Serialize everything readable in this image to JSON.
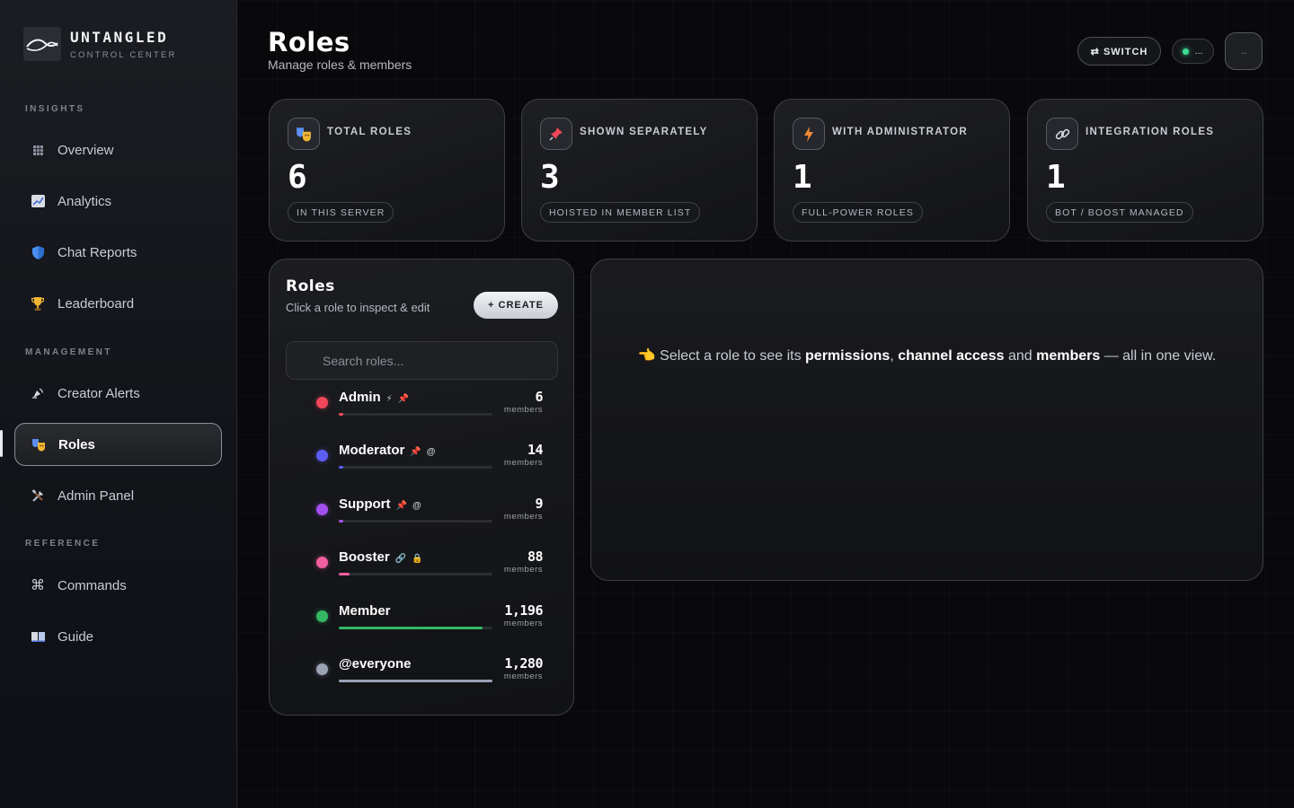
{
  "brand": {
    "name": "UNTANGLED",
    "subtitle": "CONTROL CENTER"
  },
  "sidebar": {
    "sections": {
      "insights": "INSIGHTS",
      "management": "MANAGEMENT",
      "reference": "REFERENCE"
    },
    "items": [
      {
        "label": "Overview",
        "icon": "grid-icon"
      },
      {
        "label": "Analytics",
        "icon": "chart-icon"
      },
      {
        "label": "Chat Reports",
        "icon": "shield-icon"
      },
      {
        "label": "Leaderboard",
        "icon": "trophy-icon"
      },
      {
        "label": "Creator Alerts",
        "icon": "broadcast-icon"
      },
      {
        "label": "Roles",
        "icon": "masks-icon",
        "active": true
      },
      {
        "label": "Admin Panel",
        "icon": "tools-icon"
      },
      {
        "label": "Commands",
        "icon": "command-icon"
      },
      {
        "label": "Guide",
        "icon": "book-icon"
      }
    ]
  },
  "header": {
    "title": "Roles",
    "subtitle": "Manage roles & members",
    "switch_label": "⇄ SWITCH",
    "status_text": "...",
    "avatar_text": ".."
  },
  "stats": [
    {
      "label": "TOTAL ROLES",
      "value": "6",
      "chip": "IN THIS SERVER",
      "icon": "masks-icon"
    },
    {
      "label": "SHOWN SEPARATELY",
      "value": "3",
      "chip": "HOISTED IN MEMBER LIST",
      "icon": "pin-icon"
    },
    {
      "label": "WITH ADMINISTRATOR",
      "value": "1",
      "chip": "FULL-POWER ROLES",
      "icon": "bolt-icon"
    },
    {
      "label": "INTEGRATION ROLES",
      "value": "1",
      "chip": "BOT / BOOST MANAGED",
      "icon": "link-icon"
    }
  ],
  "roles_panel": {
    "title": "Roles",
    "subtitle": "Click a role to inspect & edit",
    "create_label": "+ CREATE",
    "search_placeholder": "Search roles...",
    "members_label": "members",
    "roles": [
      {
        "name": "Admin",
        "count": "6",
        "color": "#f0485a",
        "bar": 0.005,
        "badges": [
          "⚡",
          "📌"
        ]
      },
      {
        "name": "Moderator",
        "count": "14",
        "color": "#5b5ef0",
        "bar": 0.011,
        "badges": [
          "📌",
          "@"
        ]
      },
      {
        "name": "Support",
        "count": "9",
        "color": "#a44ff0",
        "bar": 0.007,
        "badges": [
          "📌",
          "@"
        ]
      },
      {
        "name": "Booster",
        "count": "88",
        "color": "#f05fa0",
        "bar": 0.069,
        "badges": [
          "🔗",
          "🔒"
        ]
      },
      {
        "name": "Member",
        "count": "1,196",
        "color": "#34b864",
        "bar": 0.934,
        "badges": []
      },
      {
        "name": "@everyone",
        "count": "1,280",
        "color": "#9aa2b4",
        "bar": 1.0,
        "badges": []
      }
    ]
  },
  "detail": {
    "emoji": "👈",
    "text_1": "Select a role to see its",
    "strong_1": "permissions",
    "strong_2": "channel access",
    "text_2": "and",
    "strong_3": "members",
    "text_3": "— all in one view."
  },
  "colors": {
    "accent_green": "#3ddc97",
    "active_border": "#8c9099"
  }
}
